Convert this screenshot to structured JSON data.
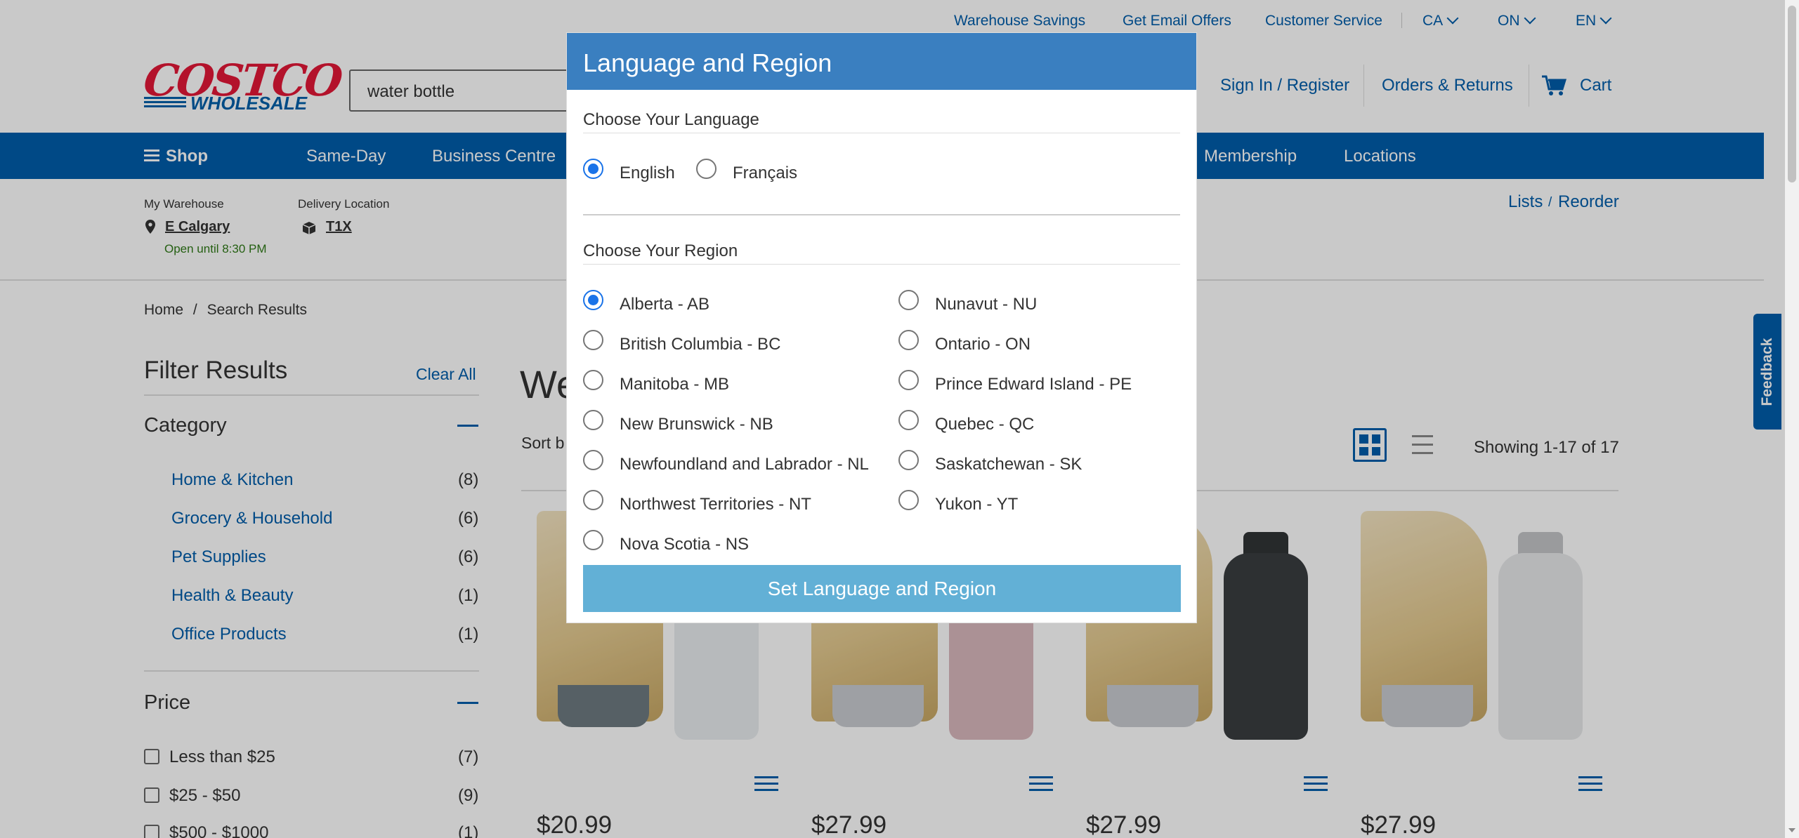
{
  "utility_links": {
    "warehouse_savings": "Warehouse Savings",
    "email_offers": "Get Email Offers",
    "customer_service": "Customer Service",
    "country": "CA",
    "province": "ON",
    "language": "EN"
  },
  "logo": {
    "top": "COSTCO",
    "bottom": "WHOLESALE"
  },
  "search": {
    "value": "water bottle"
  },
  "header": {
    "sign_in": "Sign In / Register",
    "orders": "Orders & Returns",
    "cart": "Cart"
  },
  "nav": {
    "shop": "Shop",
    "items": [
      "Same-Day",
      "Business Centre",
      "Membership",
      "Locations"
    ]
  },
  "warehouse": {
    "my_warehouse_label": "My Warehouse",
    "my_warehouse_value": "E Calgary",
    "open_until": "Open until 8:30 PM",
    "delivery_label": "Delivery Location",
    "delivery_value": "T1X"
  },
  "lists": {
    "lists": "Lists",
    "sep": "/",
    "reorder": "Reorder"
  },
  "breadcrumb": {
    "home": "Home",
    "sep": "/",
    "current": "Search Results"
  },
  "filters": {
    "title": "Filter Results",
    "clear_all": "Clear All",
    "category_title": "Category",
    "categories": [
      {
        "label": "Home & Kitchen",
        "count": "(8)"
      },
      {
        "label": "Grocery & Household",
        "count": "(6)"
      },
      {
        "label": "Pet Supplies",
        "count": "(6)"
      },
      {
        "label": "Health & Beauty",
        "count": "(1)"
      },
      {
        "label": "Office Products",
        "count": "(1)"
      }
    ],
    "price_title": "Price",
    "prices": [
      {
        "label": "Less than $25",
        "count": "(7)"
      },
      {
        "label": "$25 - $50",
        "count": "(9)"
      },
      {
        "label": "$500 - $1000",
        "count": "(1)"
      }
    ]
  },
  "results": {
    "heading_partial": "We",
    "sort_partial": "Sort b",
    "showing": "Showing 1-17 of 17"
  },
  "products": [
    {
      "price": "$20.99",
      "bottle_color": "#e9ecef",
      "bowl_color": "#6d7a80"
    },
    {
      "price": "$27.99",
      "bottle_color": "#d9b8bd",
      "bowl_color": "#c9ccd0"
    },
    {
      "price": "$27.99",
      "bottle_color": "#3a3d40",
      "bowl_color": "#c9ccd0"
    },
    {
      "price": "$27.99",
      "bottle_color": "#e7e8ea",
      "bowl_color": "#c9ccd0"
    }
  ],
  "feedback": "Feedback",
  "modal": {
    "title": "Language and Region",
    "language_label": "Choose Your Language",
    "languages": [
      {
        "label": "English",
        "selected": true
      },
      {
        "label": "Français",
        "selected": false
      }
    ],
    "region_label": "Choose Your Region",
    "regions_left": [
      {
        "label": "Alberta - AB",
        "selected": true
      },
      {
        "label": "British Columbia - BC",
        "selected": false
      },
      {
        "label": "Manitoba - MB",
        "selected": false
      },
      {
        "label": "New Brunswick - NB",
        "selected": false
      },
      {
        "label": "Newfoundland and Labrador - NL",
        "selected": false
      },
      {
        "label": "Northwest Territories - NT",
        "selected": false
      },
      {
        "label": "Nova Scotia - NS",
        "selected": false
      }
    ],
    "regions_right": [
      {
        "label": "Nunavut - NU",
        "selected": false
      },
      {
        "label": "Ontario - ON",
        "selected": false
      },
      {
        "label": "Prince Edward Island - PE",
        "selected": false
      },
      {
        "label": "Quebec - QC",
        "selected": false
      },
      {
        "label": "Saskatchewan - SK",
        "selected": false
      },
      {
        "label": "Yukon - YT",
        "selected": false
      }
    ],
    "submit": "Set Language and Region"
  },
  "colors": {
    "brand_blue": "#005daa",
    "modal_header": "#3a7fc0",
    "submit_button": "#62b0d6",
    "logo_red": "#e31837"
  }
}
